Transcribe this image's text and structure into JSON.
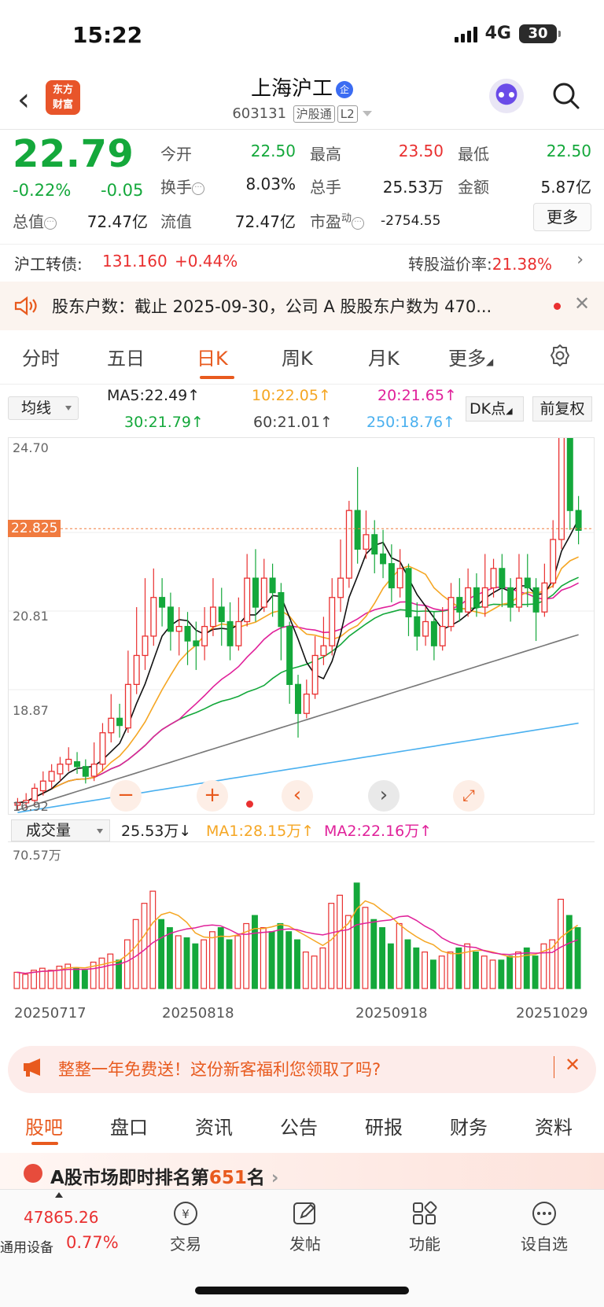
{
  "status": {
    "time": "15:22",
    "network": "4G",
    "battery": "30"
  },
  "header": {
    "title": "上海沪工",
    "badge": "企",
    "code": "603131",
    "tag1": "沪股通",
    "tag2": "L2",
    "logo_line1": "东方",
    "logo_line2": "财富"
  },
  "quote": {
    "price": "22.79",
    "change_pct": "-0.22%",
    "change_amt": "-0.05",
    "open_label": "今开",
    "open": "22.50",
    "high_label": "最高",
    "high": "23.50",
    "low_label": "最低",
    "low": "22.50",
    "turnover_label": "换手",
    "turnover": "8.03%",
    "volume_label": "总手",
    "volume": "25.53万",
    "amount_label": "金额",
    "amount": "5.87亿",
    "mktcap_label": "总值",
    "mktcap": "72.47亿",
    "float_label": "流值",
    "float": "72.47亿",
    "pe_label": "市盈",
    "pe_sup": "动",
    "pe": "-2754.55",
    "more": "更多"
  },
  "bond": {
    "label": "沪工转债:",
    "price": "131.160",
    "change": "+0.44%",
    "premium_label": "转股溢价率:",
    "premium": "21.38%"
  },
  "notice": {
    "text": "股东户数：截止 2025-09-30，公司 A 股股东户数为 470..."
  },
  "ktabs": [
    "分时",
    "五日",
    "日K",
    "周K",
    "月K",
    "更多"
  ],
  "ma": {
    "select": "均线",
    "ma5": "MA5:22.49↑",
    "ma10": "10:22.05↑",
    "ma20": "20:21.65↑",
    "ma30": "30:21.79↑",
    "ma60": "60:21.01↑",
    "ma250": "250:18.76↑",
    "dk": "DK点",
    "fq": "前复权"
  },
  "chart_labels": {
    "p_top": "24.70",
    "p_mid": "20.81",
    "p_low": "18.87",
    "p_bot": "16.92",
    "p_cur": "22.825"
  },
  "volume": {
    "select": "成交量",
    "current": "25.53万↓",
    "ma1": "MA1:28.15万↑",
    "ma2": "MA2:22.16万↑",
    "max": "70.57万"
  },
  "dates": [
    "20250717",
    "20250818",
    "20250918",
    "20251029"
  ],
  "promo": {
    "text": "整整一年免费送！这份新客福利您领取了吗?"
  },
  "btabs": [
    "股吧",
    "盘口",
    "资讯",
    "公告",
    "研报",
    "财务",
    "资料"
  ],
  "rank": {
    "prefix": "A股市场即时排名第",
    "num": "651",
    "suffix": "名"
  },
  "bottom": {
    "index_value": "47865.26",
    "index_name": "通用设备",
    "index_change": "0.77%",
    "nav": [
      "交易",
      "发帖",
      "功能",
      "设自选"
    ]
  },
  "chart_data": {
    "type": "candlestick",
    "ylim": [
      16.92,
      24.7
    ],
    "price_ticks": [
      "24.70",
      "20.81",
      "18.87",
      "16.92"
    ],
    "current_price": 22.825,
    "x_ticks": [
      "20250717",
      "20250818",
      "20250918",
      "20251029"
    ],
    "candles": [
      [
        17.1,
        17.15,
        17.0,
        17.25
      ],
      [
        17.15,
        17.2,
        17.05,
        17.35
      ],
      [
        17.2,
        17.45,
        17.1,
        17.55
      ],
      [
        17.4,
        17.6,
        17.3,
        17.8
      ],
      [
        17.6,
        17.8,
        17.45,
        17.95
      ],
      [
        17.75,
        17.95,
        17.6,
        18.1
      ],
      [
        17.95,
        18.05,
        17.8,
        18.3
      ],
      [
        18.0,
        17.9,
        17.75,
        18.2
      ],
      [
        17.9,
        17.7,
        17.55,
        18.05
      ],
      [
        17.7,
        17.95,
        17.6,
        18.4
      ],
      [
        17.95,
        18.6,
        17.8,
        18.8
      ],
      [
        18.6,
        18.9,
        18.4,
        19.4
      ],
      [
        18.9,
        18.75,
        18.5,
        19.2
      ],
      [
        18.7,
        19.6,
        18.6,
        20.3
      ],
      [
        19.6,
        20.2,
        19.4,
        21.2
      ],
      [
        20.2,
        20.6,
        19.9,
        21.8
      ],
      [
        20.6,
        21.4,
        20.4,
        22.0
      ],
      [
        21.4,
        21.2,
        20.8,
        21.8
      ],
      [
        21.2,
        20.7,
        20.3,
        21.5
      ],
      [
        20.7,
        20.8,
        20.2,
        21.2
      ],
      [
        20.8,
        20.5,
        20.0,
        21.1
      ],
      [
        20.5,
        20.4,
        19.9,
        20.9
      ],
      [
        20.4,
        20.8,
        20.1,
        21.2
      ],
      [
        20.8,
        21.2,
        20.6,
        21.8
      ],
      [
        21.2,
        20.9,
        20.4,
        21.6
      ],
      [
        20.9,
        20.4,
        20.1,
        21.3
      ],
      [
        20.4,
        20.9,
        20.3,
        21.4
      ],
      [
        20.9,
        21.8,
        20.8,
        22.3
      ],
      [
        21.8,
        21.2,
        20.9,
        22.4
      ],
      [
        21.2,
        21.8,
        21.1,
        22.2
      ],
      [
        21.8,
        21.5,
        21.0,
        22.1
      ],
      [
        21.5,
        20.8,
        20.1,
        21.7
      ],
      [
        20.8,
        19.6,
        19.2,
        20.9
      ],
      [
        19.6,
        19.0,
        18.5,
        19.8
      ],
      [
        19.0,
        19.4,
        18.9,
        19.7
      ],
      [
        19.4,
        20.2,
        19.3,
        20.6
      ],
      [
        20.2,
        20.4,
        20.0,
        21.0
      ],
      [
        20.4,
        21.4,
        20.2,
        21.8
      ],
      [
        21.4,
        21.8,
        21.1,
        22.6
      ],
      [
        21.8,
        23.2,
        21.6,
        23.4
      ],
      [
        23.2,
        22.4,
        22.1,
        24.1
      ],
      [
        22.4,
        22.7,
        22.2,
        23.2
      ],
      [
        22.7,
        22.3,
        21.9,
        23.0
      ],
      [
        22.3,
        22.1,
        21.8,
        22.8
      ],
      [
        22.1,
        21.6,
        21.3,
        22.5
      ],
      [
        21.6,
        22.0,
        21.4,
        22.4
      ],
      [
        22.0,
        21.0,
        20.6,
        22.1
      ],
      [
        21.0,
        20.6,
        20.3,
        21.3
      ],
      [
        20.6,
        20.9,
        20.4,
        21.2
      ],
      [
        20.9,
        20.4,
        20.1,
        21.1
      ],
      [
        20.4,
        20.8,
        20.3,
        21.2
      ],
      [
        20.8,
        21.4,
        20.7,
        21.7
      ],
      [
        21.4,
        21.1,
        20.9,
        21.8
      ],
      [
        21.1,
        21.6,
        21.0,
        22.0
      ],
      [
        21.6,
        21.2,
        21.0,
        21.9
      ],
      [
        21.2,
        21.6,
        21.0,
        22.3
      ],
      [
        21.6,
        22.0,
        21.4,
        22.2
      ],
      [
        22.0,
        21.6,
        21.2,
        22.3
      ],
      [
        21.6,
        21.2,
        20.9,
        21.8
      ],
      [
        21.2,
        21.8,
        21.1,
        22.3
      ],
      [
        21.8,
        21.6,
        21.2,
        22.3
      ],
      [
        21.6,
        21.1,
        20.5,
        21.8
      ],
      [
        21.1,
        21.7,
        21.0,
        22.1
      ],
      [
        21.7,
        22.6,
        21.6,
        23.0
      ],
      [
        22.6,
        24.8,
        22.4,
        24.8
      ],
      [
        24.8,
        23.2,
        22.8,
        24.9
      ],
      [
        23.2,
        22.79,
        22.5,
        23.5
      ]
    ],
    "volume": [
      8,
      7,
      9,
      10,
      9,
      11,
      12,
      10,
      9,
      13,
      15,
      17,
      14,
      24,
      34,
      42,
      48,
      34,
      30,
      26,
      25,
      22,
      24,
      28,
      30,
      24,
      26,
      32,
      36,
      30,
      28,
      32,
      28,
      24,
      18,
      16,
      20,
      42,
      46,
      36,
      52,
      40,
      34,
      30,
      22,
      32,
      24,
      20,
      18,
      14,
      16,
      18,
      20,
      22,
      18,
      16,
      14,
      14,
      16,
      18,
      20,
      16,
      22,
      24,
      44,
      36,
      30
    ],
    "volume_ylim": [
      0,
      70.57
    ]
  }
}
